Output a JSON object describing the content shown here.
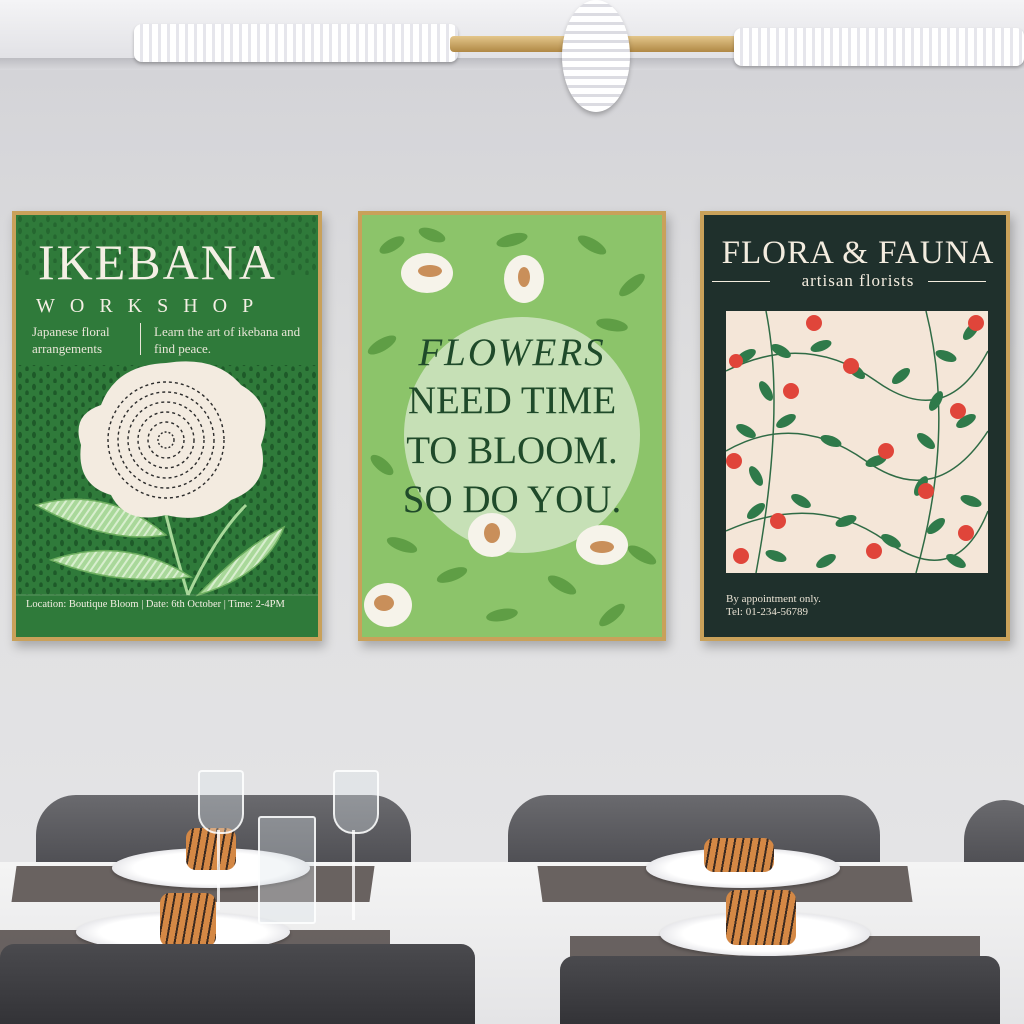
{
  "posters": {
    "ikebana": {
      "title": "IKEBANA",
      "subtitle": "WORKSHOP",
      "left_note": "Japanese floral arrangements",
      "right_note": "Learn the art of ikebana and find peace.",
      "info": "Location: Boutique Bloom | Date: 6th October | Time: 2-4PM"
    },
    "flowers": {
      "line1": "FLOWERS",
      "line2": "NEED TIME",
      "line3": "TO BLOOM.",
      "line4": "SO DO YOU."
    },
    "flora": {
      "title": "FLORA & FAUNA",
      "subtitle": "artisan florists",
      "note1": "By appointment only.",
      "note2": "Tel: 01-234-56789"
    }
  },
  "colors": {
    "wall": "#dcdcdf",
    "frame": "#c9a15a",
    "ikebana_green": "#2f7a3a",
    "flowers_green": "#8cc46a",
    "flora_dark": "#1f302c",
    "flower_red": "#e0453a"
  }
}
